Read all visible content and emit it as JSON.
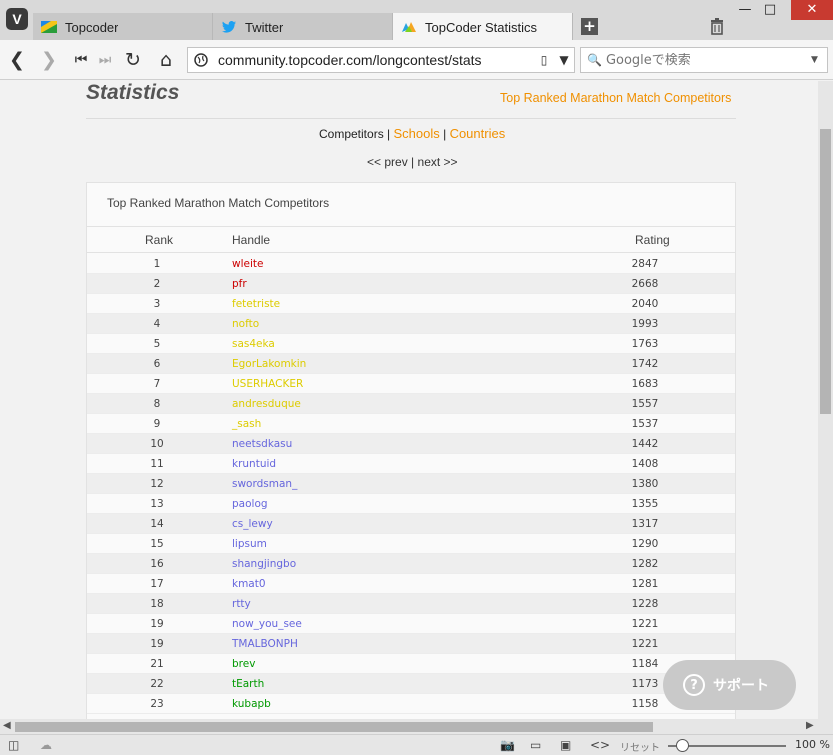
{
  "browser": {
    "tabs": [
      {
        "label": "Topcoder",
        "active": false
      },
      {
        "label": "Twitter",
        "active": false
      },
      {
        "label": "TopCoder Statistics",
        "active": true
      }
    ],
    "url": "community.topcoder.com/longcontest/stats",
    "search_placeholder": "Googleで検索",
    "zoom_label": "リセット",
    "zoom_value": "100 %",
    "zoom_level": 1.0
  },
  "page": {
    "title": "Statistics",
    "top_link": "Top Ranked Marathon Match Competitors",
    "subnav": {
      "current": "Competitors",
      "separator": "|",
      "schools": "Schools",
      "countries": "Countries"
    },
    "pager": {
      "prev": "<< prev",
      "separator": "|",
      "next": "next >>"
    },
    "table_title": "Top Ranked Marathon Match Competitors",
    "columns": {
      "rank": "Rank",
      "handle": "Handle",
      "rating": "Rating"
    },
    "rows": [
      {
        "rank": "1",
        "handle": "wleite",
        "rating": "2847",
        "color": "#cc0000"
      },
      {
        "rank": "2",
        "handle": "pfr",
        "rating": "2668",
        "color": "#cc0000"
      },
      {
        "rank": "3",
        "handle": "fetetriste",
        "rating": "2040",
        "color": "#ddcc00"
      },
      {
        "rank": "4",
        "handle": "nofto",
        "rating": "1993",
        "color": "#ddcc00"
      },
      {
        "rank": "5",
        "handle": "sas4eka",
        "rating": "1763",
        "color": "#ddcc00"
      },
      {
        "rank": "6",
        "handle": "EgorLakomkin",
        "rating": "1742",
        "color": "#ddcc00"
      },
      {
        "rank": "7",
        "handle": "USERHACKER",
        "rating": "1683",
        "color": "#ddcc00"
      },
      {
        "rank": "8",
        "handle": "andresduque",
        "rating": "1557",
        "color": "#ddcc00"
      },
      {
        "rank": "9",
        "handle": "_sash",
        "rating": "1537",
        "color": "#ddcc00"
      },
      {
        "rank": "10",
        "handle": "neetsdkasu",
        "rating": "1442",
        "color": "#6666dd"
      },
      {
        "rank": "11",
        "handle": "kruntuid",
        "rating": "1408",
        "color": "#6666dd"
      },
      {
        "rank": "12",
        "handle": "swordsman_",
        "rating": "1380",
        "color": "#6666dd"
      },
      {
        "rank": "13",
        "handle": "paolog",
        "rating": "1355",
        "color": "#6666dd"
      },
      {
        "rank": "14",
        "handle": "cs_lewy",
        "rating": "1317",
        "color": "#6666dd"
      },
      {
        "rank": "15",
        "handle": "lipsum",
        "rating": "1290",
        "color": "#6666dd"
      },
      {
        "rank": "16",
        "handle": "shangjingbo",
        "rating": "1282",
        "color": "#6666dd"
      },
      {
        "rank": "17",
        "handle": "kmat0",
        "rating": "1281",
        "color": "#6666dd"
      },
      {
        "rank": "18",
        "handle": "rtty",
        "rating": "1228",
        "color": "#6666dd"
      },
      {
        "rank": "19",
        "handle": "now_you_see",
        "rating": "1221",
        "color": "#6666dd"
      },
      {
        "rank": "19",
        "handle": "TMALBONPH",
        "rating": "1221",
        "color": "#6666dd"
      },
      {
        "rank": "21",
        "handle": "brev",
        "rating": "1184",
        "color": "#009900"
      },
      {
        "rank": "22",
        "handle": "tEarth",
        "rating": "1173",
        "color": "#009900"
      },
      {
        "rank": "23",
        "handle": "kubapb",
        "rating": "1158",
        "color": "#009900"
      }
    ]
  },
  "support_button": "サポート",
  "colors": {
    "accent": "#f09000",
    "red": "#cc0000",
    "yellow": "#ddcc00",
    "blue": "#6666dd",
    "green": "#009900"
  }
}
